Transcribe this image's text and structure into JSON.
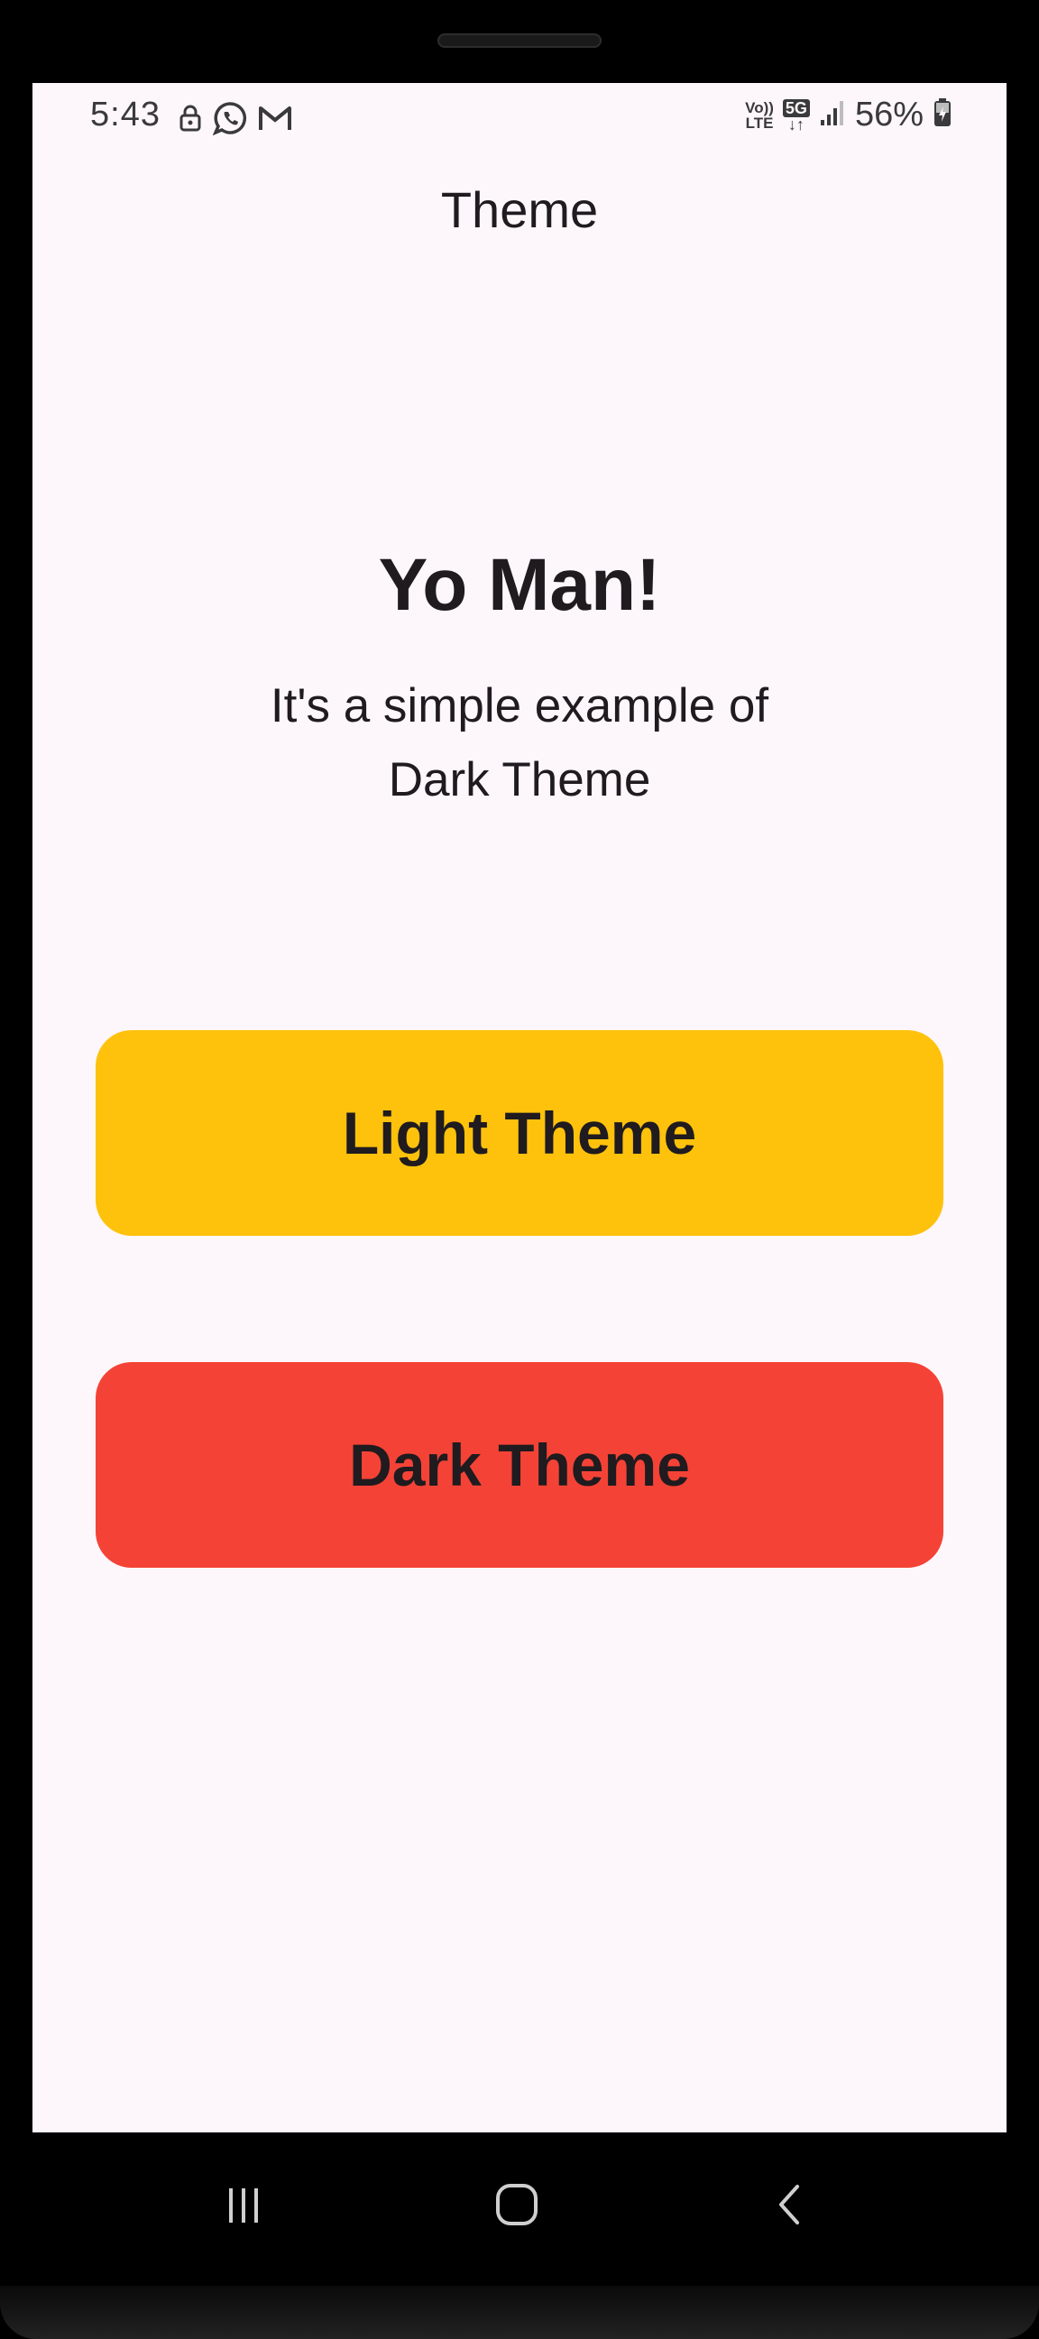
{
  "status_bar": {
    "time": "5:43",
    "left_icons": [
      "lock-icon",
      "whatsapp-icon",
      "gmail-icon"
    ],
    "volte_top": "Vo))",
    "volte_bottom": "LTE",
    "network": "5G",
    "signal_icon": "signal-icon",
    "battery_percent": "56%",
    "battery_icon": "battery-charging-icon"
  },
  "app_bar": {
    "title": "Theme"
  },
  "content": {
    "headline": "Yo Man!",
    "description": "It's a simple example of Dark Theme"
  },
  "buttons": {
    "light_label": "Light Theme",
    "light_color": "#fec20c",
    "dark_label": "Dark Theme",
    "dark_color": "#f44336"
  },
  "navigation_bar": {
    "recents_icon": "recents-icon",
    "home_icon": "home-icon",
    "back_icon": "back-icon"
  },
  "colors": {
    "background": "#fdf7fc",
    "text": "#1f1b1f"
  }
}
